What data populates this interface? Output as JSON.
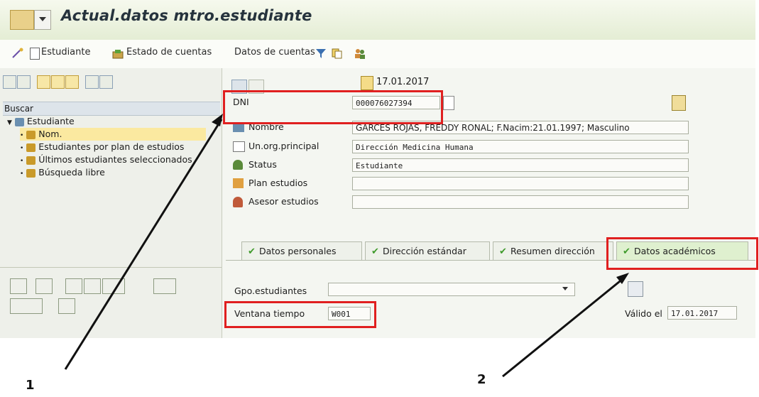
{
  "window": {
    "title": "Actual.datos mtro.estudiante"
  },
  "toolbar": {
    "estudiante": "Estudiante",
    "estado_cuentas": "Estado de cuentas",
    "datos_cuentas": "Datos de cuentas"
  },
  "left_panel": {
    "search_label": "Buscar",
    "tree": {
      "root": "Estudiante",
      "items": [
        "Nom.",
        "Estudiantes por plan de estudios",
        "Últimos estudiantes seleccionados",
        "Búsqueda libre"
      ]
    }
  },
  "header": {
    "date": "17.01.2017"
  },
  "form": {
    "dni": {
      "label": "DNI",
      "value": "000076027394"
    },
    "nombre": {
      "label": "Nombre",
      "value": "GARCES ROJAS, FREDDY RONAL; F.Nacim:21.01.1997; Masculino"
    },
    "unorg": {
      "label": "Un.org.principal",
      "value": "Dirección Medicina Humana"
    },
    "status": {
      "label": "Status",
      "value": "Estudiante"
    },
    "plan": {
      "label": "Plan estudios",
      "value": ""
    },
    "asesor": {
      "label": "Asesor estudios",
      "value": ""
    }
  },
  "tabs": [
    "Datos personales",
    "Dirección estándar",
    "Resumen dirección",
    "Datos académicos"
  ],
  "active_tab": "Datos académicos",
  "academic": {
    "gpo": {
      "label": "Gpo.estudiantes",
      "value": ""
    },
    "ventana": {
      "label": "Ventana tiempo",
      "value": "W001"
    },
    "valido": {
      "label": "Válido el",
      "value": "17.01.2017"
    }
  },
  "annotations": {
    "one": "1",
    "two": "2"
  },
  "colors": {
    "highlight": "#e02020",
    "title_bg": "#e4edd4",
    "check": "#3e9a2a"
  }
}
